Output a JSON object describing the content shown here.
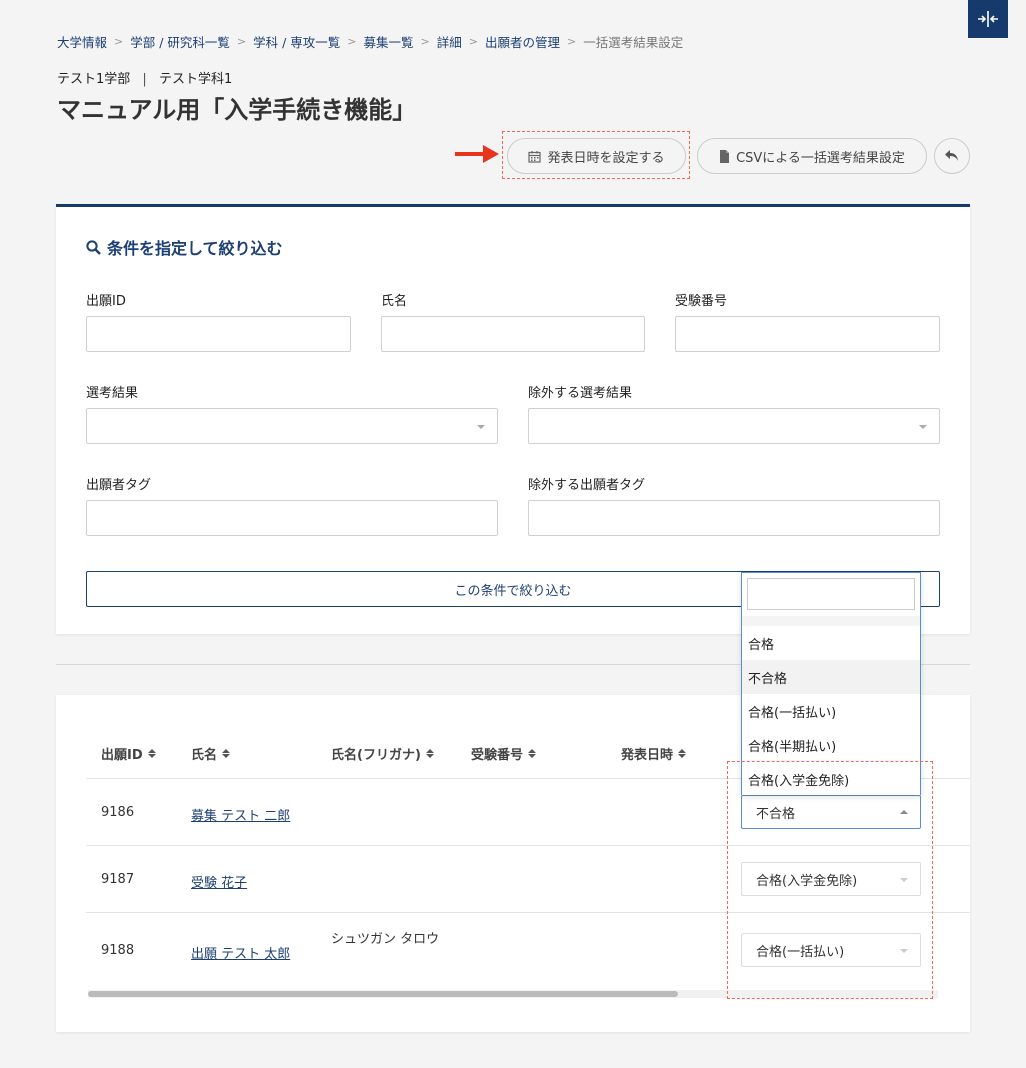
{
  "breadcrumb": [
    "大学情報",
    "学部 / 研究科一覧",
    "学科 / 専攻一覧",
    "募集一覧",
    "詳細",
    "出願者の管理",
    "一括選考結果設定"
  ],
  "breadcrumb_separator": ">",
  "faculty": "テスト1学部",
  "department": "テスト学科1",
  "faculty_separator": "|",
  "page_title": "マニュアル用「入学手続き機能」",
  "actions": {
    "set_release_date": "発表日時を設定する",
    "csv_bulk": "CSVによる一括選考結果設定"
  },
  "filter": {
    "title": "条件を指定して絞り込む",
    "application_id_label": "出願ID",
    "name_label": "氏名",
    "exam_number_label": "受験番号",
    "selection_result_label": "選考結果",
    "exclude_result_label": "除外する選考結果",
    "applicant_tag_label": "出願者タグ",
    "exclude_tag_label": "除外する出願者タグ",
    "apply_button": "この条件で絞り込む"
  },
  "table": {
    "headers": {
      "id": "出願ID",
      "name": "氏名",
      "kana": "氏名(フリガナ)",
      "exam_number": "受験番号",
      "release_date": "発表日時"
    },
    "rows": [
      {
        "id": "9186",
        "name": "募集 テスト 二郎",
        "kana": "",
        "result": "不合格"
      },
      {
        "id": "9187",
        "name": "受験 花子",
        "kana": "",
        "result": "合格(入学金免除)"
      },
      {
        "id": "9188",
        "name": "出願 テスト 太郎",
        "kana": "シュツガン タロウ",
        "result": "合格(一括払い)"
      }
    ]
  },
  "dropdown": {
    "search_value": "",
    "options": [
      "合格",
      "不合格",
      "合格(一括払い)",
      "合格(半期払い)",
      "合格(入学金免除)"
    ]
  },
  "colors": {
    "primary": "#153a6b",
    "link": "#1c3f74",
    "annotation": "#f26a57"
  }
}
